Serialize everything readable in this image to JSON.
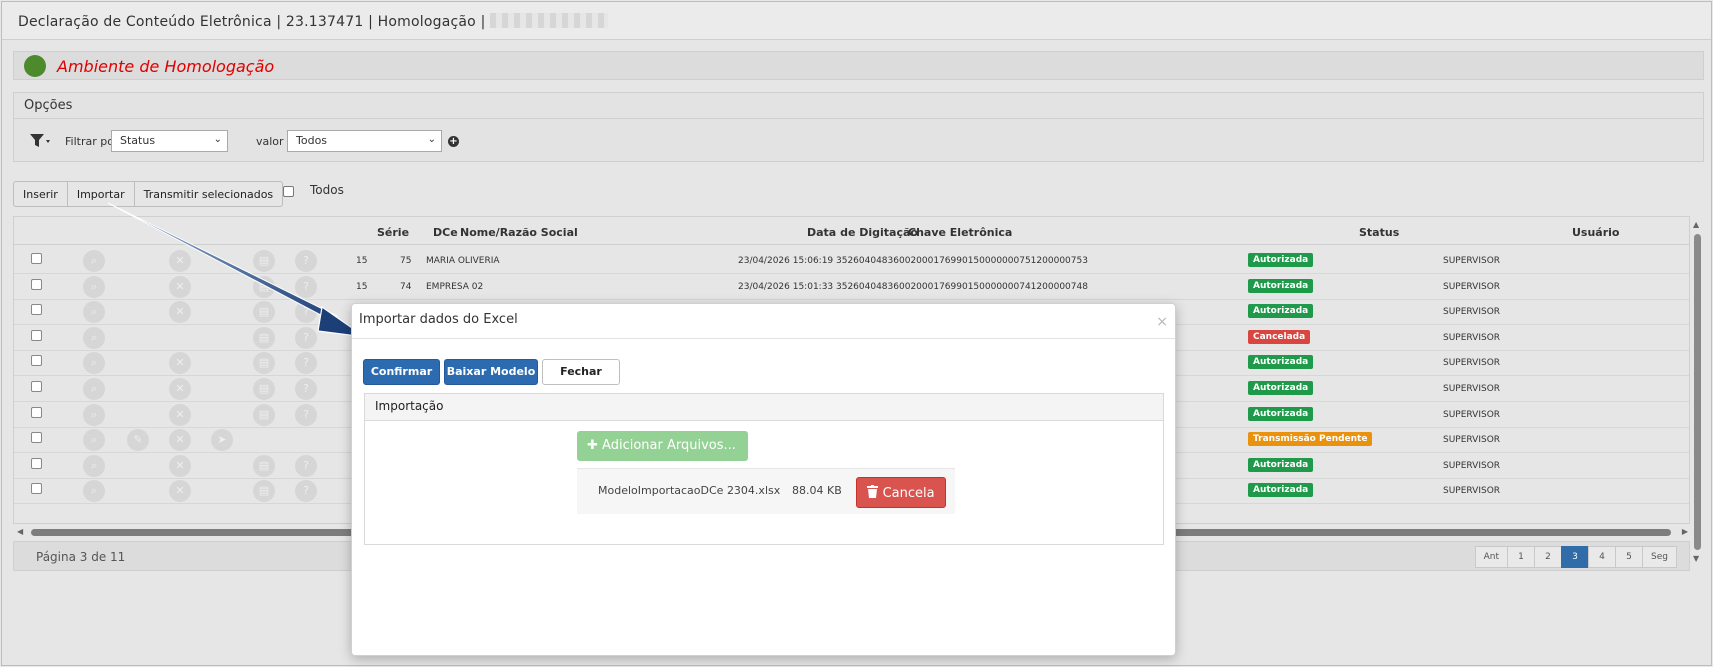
{
  "window": {
    "title": "Declaração de Conteúdo Eletrônica | 23.137471 | Homologação |"
  },
  "environment": {
    "label": "Ambiente de Homologação",
    "indicator_color": "#4c8a2b"
  },
  "options": {
    "header": "Opções",
    "filter_label": "Filtrar por",
    "filter_field": "Status",
    "value_label": "valor",
    "value_field": "Todos"
  },
  "toolbar": {
    "insert": "Inserir",
    "import": "Importar",
    "transmit": "Transmitir selecionados",
    "select_all": "Todos"
  },
  "grid": {
    "columns": {
      "serie": "Série",
      "dce": "DCe",
      "name": "Nome/Razão Social",
      "date": "Data de Digitação",
      "key": "Chave Eletrônica",
      "status": "Status",
      "user": "Usuário"
    },
    "rows": [
      {
        "serie": "15",
        "dce": "75",
        "name": "MARIA OLIVERIA",
        "date": "23/04/2026 15:06:19",
        "key": "35260404836002000176990150000000751200000753",
        "status": "Autorizada",
        "user": "SUPERVISOR"
      },
      {
        "serie": "15",
        "dce": "74",
        "name": "EMPRESA 02",
        "date": "23/04/2026 15:01:33",
        "key": "35260404836002000176990150000000741200000748",
        "status": "Autorizada",
        "user": "SUPERVISOR"
      },
      {
        "serie": "",
        "dce": "",
        "name": "",
        "date": "",
        "key": "",
        "status": "Autorizada",
        "user": "SUPERVISOR"
      },
      {
        "serie": "",
        "dce": "",
        "name": "",
        "date": "",
        "key": "",
        "status": "Cancelada",
        "user": "SUPERVISOR"
      },
      {
        "serie": "",
        "dce": "",
        "name": "",
        "date": "",
        "key": "",
        "status": "Autorizada",
        "user": "SUPERVISOR"
      },
      {
        "serie": "",
        "dce": "",
        "name": "",
        "date": "",
        "key": "",
        "status": "Autorizada",
        "user": "SUPERVISOR"
      },
      {
        "serie": "",
        "dce": "",
        "name": "",
        "date": "",
        "key": "",
        "status": "Autorizada",
        "user": "SUPERVISOR"
      },
      {
        "serie": "",
        "dce": "",
        "name": "",
        "date": "",
        "key": "",
        "status": "Transmissão Pendente",
        "user": "SUPERVISOR"
      },
      {
        "serie": "",
        "dce": "",
        "name": "",
        "date": "",
        "key": "",
        "status": "Autorizada",
        "user": "SUPERVISOR"
      },
      {
        "serie": "",
        "dce": "",
        "name": "",
        "date": "",
        "key": "",
        "status": "Autorizada",
        "user": "SUPERVISOR"
      }
    ],
    "status_colors": {
      "Autorizada": "#1f9a4a",
      "Cancelada": "#d9453f",
      "Transmissão Pendente": "#e8920f"
    }
  },
  "footer": {
    "page_info": "Página 3 de 11",
    "pager": [
      "Ant",
      "1",
      "2",
      "3",
      "4",
      "5",
      "Seg"
    ],
    "active_page": "3"
  },
  "modal": {
    "title": "Importar dados do Excel",
    "close": "×",
    "confirm": "Confirmar",
    "download_template": "Baixar Modelo",
    "close_button": "Fechar",
    "panel_title": "Importação",
    "add_files": "Adicionar Arquivos...",
    "file_name": "ModeloImportacaoDCe 2304.xlsx",
    "file_size": "88.04 KB",
    "cancel": "Cancela"
  },
  "icons": {
    "filter": "filter-icon",
    "plus": "plus-circle-icon",
    "add": "plus-icon",
    "trash": "trash-icon"
  }
}
